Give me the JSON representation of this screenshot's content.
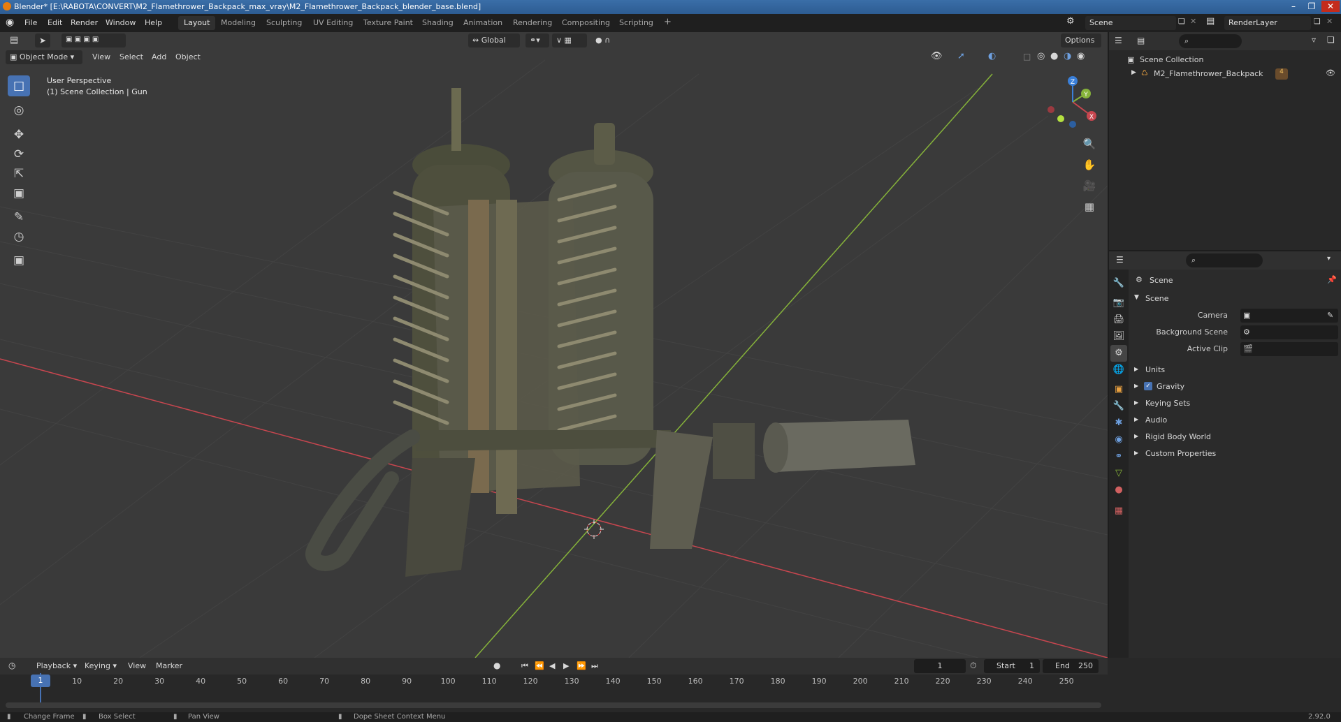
{
  "window": {
    "title": "Blender* [E:\\RABOTA\\CONVERT\\M2_Flamethrower_Backpack_max_vray\\M2_Flamethrower_Backpack_blender_base.blend]",
    "minimize": "–",
    "maximize": "❐",
    "close": "✕"
  },
  "menubar": {
    "menus": [
      "File",
      "Edit",
      "Render",
      "Window",
      "Help"
    ],
    "workspaces": [
      "Layout",
      "Modeling",
      "Sculpting",
      "UV Editing",
      "Texture Paint",
      "Shading",
      "Animation",
      "Rendering",
      "Compositing",
      "Scripting"
    ],
    "active_workspace": "Layout",
    "add_tab": "+",
    "scene": "Scene",
    "view_layer": "RenderLayer"
  },
  "viewport": {
    "transform_orientation": "Global",
    "options_label": "Options",
    "mode": "Object Mode",
    "menus": [
      "View",
      "Select",
      "Add",
      "Object"
    ],
    "overlay_line1": "User Perspective",
    "overlay_line2": "(1) Scene Collection | Gun",
    "gizmo_axes": {
      "x": "X",
      "y": "Y",
      "z": "Z"
    }
  },
  "toolbar": {
    "tools": [
      "select-box",
      "cursor",
      "move",
      "rotate",
      "scale",
      "transform",
      "annotate",
      "measure",
      "add-cube"
    ],
    "active_tool": "select-box"
  },
  "outliner": {
    "root": "Scene Collection",
    "items": [
      {
        "name": "M2_Flamethrower_Backpack",
        "badge": "4"
      }
    ]
  },
  "properties": {
    "context": "Scene",
    "panel_title": "Scene",
    "fields": [
      {
        "label": "Camera",
        "value": ""
      },
      {
        "label": "Background Scene",
        "value": ""
      },
      {
        "label": "Active Clip",
        "value": ""
      }
    ],
    "sections": [
      "Units",
      "Gravity",
      "Keying Sets",
      "Audio",
      "Rigid Body World",
      "Custom Properties"
    ],
    "gravity_checked": true
  },
  "timeline": {
    "menus": [
      "Playback",
      "Keying",
      "View",
      "Marker"
    ],
    "current_frame": "1",
    "start_label": "Start",
    "start": "1",
    "end_label": "End",
    "end": "250",
    "ruler": [
      "1",
      "10",
      "20",
      "30",
      "40",
      "50",
      "60",
      "70",
      "80",
      "90",
      "100",
      "110",
      "120",
      "130",
      "140",
      "150",
      "160",
      "170",
      "180",
      "190",
      "200",
      "210",
      "220",
      "230",
      "240",
      "250"
    ]
  },
  "statusbar": {
    "items": [
      "Change Frame",
      "Box Select",
      "Pan View",
      "Dope Sheet Context Menu"
    ],
    "version": "2.92.0"
  },
  "colors": {
    "accent": "#4772b3",
    "x_axis": "#c8464f",
    "y_axis": "#86b33a",
    "z_axis": "#3a7fd8",
    "viewport_bg": "#393939"
  }
}
